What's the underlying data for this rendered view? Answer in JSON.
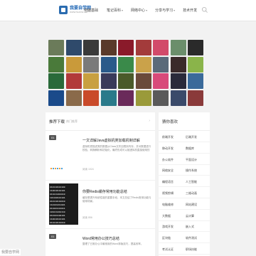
{
  "header": {
    "logo_name": "我要自学网",
    "logo_sub": "WWW.51ZXW.NET",
    "nav": [
      {
        "label": "电脑基础",
        "caret": ""
      },
      {
        "label": "笔记百科",
        "caret": "▾"
      },
      {
        "label": "网络中心",
        "caret": "▾"
      },
      {
        "label": "分享与学习",
        "caret": "▾"
      },
      {
        "label": "技术开发",
        "caret": ""
      }
    ]
  },
  "tiles": [
    {
      "color": "#6b7b5a"
    },
    {
      "color": "#2f4a6b"
    },
    {
      "color": "#3a3a3a"
    },
    {
      "color": "#5a3a2a"
    },
    {
      "color": "#8a1a2a"
    },
    {
      "color": "#a33b3b"
    },
    {
      "color": "#d24a6a"
    },
    {
      "color": "#6b8e6b"
    },
    {
      "color": "#2a2a2a"
    },
    {
      "color": "#4a7a3a"
    },
    {
      "color": "#c99a3a"
    },
    {
      "color": "#7a7a7a"
    },
    {
      "color": "#2a5a8a"
    },
    {
      "color": "#3a8a4a"
    },
    {
      "color": "#caa24a"
    },
    {
      "color": "#5a6a7a"
    },
    {
      "color": "#3a2a2a"
    },
    {
      "color": "#8ab44a"
    },
    {
      "color": "#2a6a3a"
    },
    {
      "color": "#b23a3a"
    },
    {
      "color": "#c8a040"
    },
    {
      "color": "#3a3a5a"
    },
    {
      "color": "#4a5a2a"
    },
    {
      "color": "#6a4a3a"
    },
    {
      "color": "#d84a7a"
    },
    {
      "color": "#2a2a3a"
    },
    {
      "color": "#3a6a9a"
    },
    {
      "color": "#1a4a8a"
    },
    {
      "color": "#8a6a4a"
    },
    {
      "color": "#c94a2a"
    },
    {
      "color": "#2a7a8a"
    },
    {
      "color": "#6a2a5a"
    },
    {
      "color": "#9a9a3a"
    },
    {
      "color": "#5a5a5a"
    },
    {
      "color": "#3a4a6a"
    },
    {
      "color": "#8a3a3a"
    }
  ],
  "main": {
    "title": "推荐下载",
    "subtitle": "热门推荐",
    "more": "›",
    "articles": [
      {
        "tag": "01",
        "title": "一文详解Java虚拟机类加载机制详解",
        "desc": "虚拟机把描述类的数据从Class文件加载到内存，并对数据进行校验、转换解析和初始化，最终形成可以被虚拟机直接使用的Java类型。",
        "meta": "阅读 1024"
      },
      {
        "tag": "",
        "title": "你要Redis缓存常用功能总结",
        "desc": "缓存是提升系统性能的重要手段，本文总结了Redis常用功能与使用场景。",
        "meta": "阅读 856"
      },
      {
        "tag": "01",
        "title": "Word常用办公技巧总结",
        "desc": "整理了日常办公中最常用的Word排版技巧，提高效率。",
        "meta": "阅读 642"
      }
    ]
  },
  "side": {
    "title": "猜你喜欢",
    "rows": [
      {
        "l": "前端开发",
        "r": "后端开发"
      },
      {
        "l": "移动开发",
        "r": "数据库"
      },
      {
        "l": "办公软件",
        "r": "平面设计"
      },
      {
        "l": "网络安全",
        "r": "操作系统"
      },
      {
        "l": "编程语言",
        "r": "人工智能"
      },
      {
        "l": "视频剪辑",
        "r": "三维动画"
      },
      {
        "l": "电脑维修",
        "r": "网站建设"
      },
      {
        "l": "大数据",
        "r": "云计算"
      },
      {
        "l": "游戏开发",
        "r": "嵌入式"
      },
      {
        "l": "区块链",
        "r": "软件测试"
      },
      {
        "l": "考试认证",
        "r": "职场技能"
      }
    ]
  },
  "status": "我要自学网"
}
